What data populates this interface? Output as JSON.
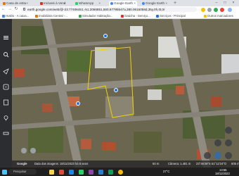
{
  "browser": {
    "tabs": [
      {
        "title": "Casa de esttu",
        "active": false
      },
      {
        "title": "Imóveis à Vend",
        "active": false
      },
      {
        "title": "WhatsApp",
        "active": false
      },
      {
        "title": "Google Earth",
        "active": true
      },
      {
        "title": "Google Earth",
        "active": false
      }
    ],
    "new_tab": "+",
    "url": "earth.google.com/web/@-23.77406461,-51.2066851,560.57795547a,380.0615058d,35y,0h,0t,0r",
    "bookmarks": [
      {
        "label": "Hotéis - A caixa..."
      },
      {
        "label": "Imobiliária Central -..."
      },
      {
        "label": "Simulador Habitação..."
      },
      {
        "label": "Gaúcha - Serviço..."
      },
      {
        "label": "Serviços - Principal"
      },
      {
        "label": "Outros marcadores"
      }
    ]
  },
  "map": {
    "attribution_left": "Google",
    "footer_left": "Data das imagens: 18/11/2023  há 8 anos",
    "footer_scale": "50 m",
    "footer_camera": "Câmera: 1.481 m",
    "footer_coords": "23°46'28\"S 51°12'24\"O",
    "footer_alt": "605 m"
  },
  "taskbar": {
    "search_placeholder": "Pesquisar",
    "time": "13:55",
    "date": "18/11/2023",
    "weather": "27°C"
  }
}
